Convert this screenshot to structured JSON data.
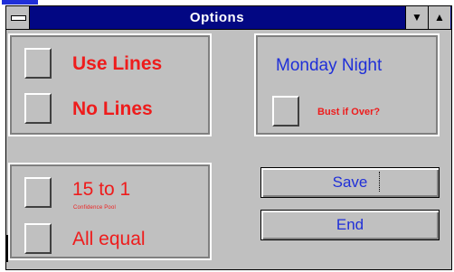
{
  "window": {
    "title": "Options"
  },
  "titlebar": {
    "min_glyph": "▼",
    "max_glyph": "▲"
  },
  "lines_group": {
    "use_lines_label": "Use Lines",
    "no_lines_label": "No Lines"
  },
  "night_group": {
    "heading": "Monday Night",
    "bust_label": "Bust if Over?"
  },
  "odds_group": {
    "odds_label": "15 to 1",
    "odds_sublabel": "Confidence Pool",
    "all_equal_label": "All equal"
  },
  "buttons": {
    "save_label": "Save",
    "end_label": "End"
  },
  "colors": {
    "titlebar": "#020783",
    "face": "#c0c0c0",
    "label_red": "#ee1c1c",
    "label_blue": "#1f2fd8"
  }
}
